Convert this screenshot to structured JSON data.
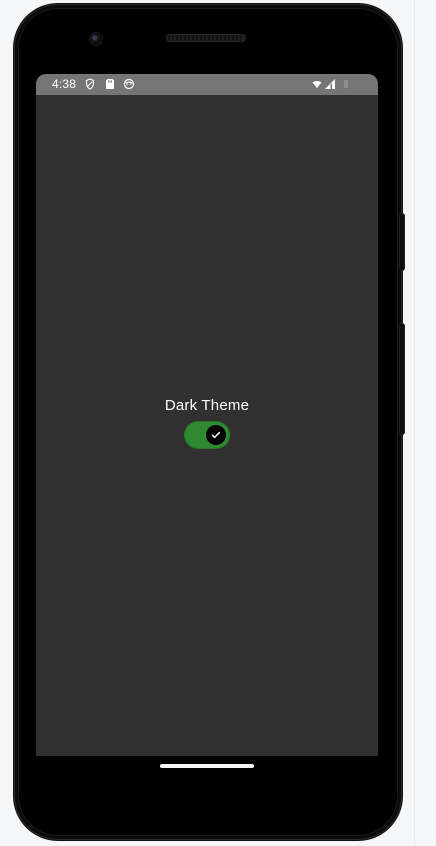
{
  "status_bar": {
    "time": "4:38",
    "icons_left": [
      "shield-icon",
      "sd-card-icon",
      "face-icon"
    ],
    "icons_right": [
      "wifi-icon",
      "cell-signal-icon",
      "battery-icon"
    ]
  },
  "setting": {
    "label": "Dark Theme",
    "toggle": {
      "checked": true,
      "on_color": "#2F8A2F",
      "knob_color": "#000000",
      "check_icon": "check-icon"
    }
  },
  "theme": {
    "status_bar_bg": "#757575",
    "content_bg": "#303030",
    "phone_bg": "#000000"
  }
}
